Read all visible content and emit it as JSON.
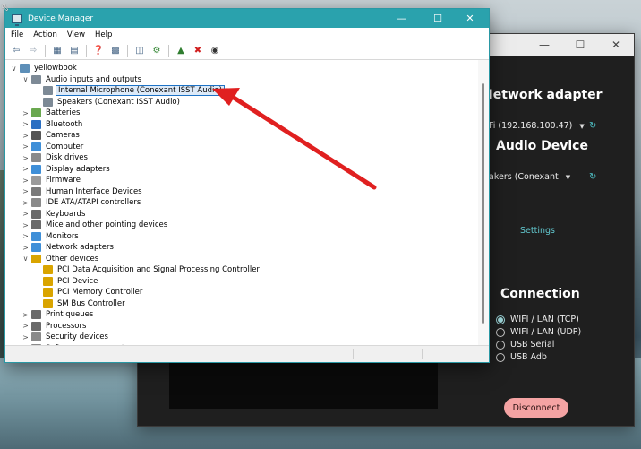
{
  "device_manager": {
    "title": "Device Manager",
    "menu": [
      "File",
      "Action",
      "View",
      "Help"
    ],
    "toolbar_icons": [
      "back-arrow-icon",
      "forward-arrow-icon",
      "properties-grid-icon",
      "list-icon",
      "help-icon",
      "properties-icon",
      "monitor-icon",
      "scan-icon",
      "update-driver-icon",
      "uninstall-icon",
      "download-icon"
    ],
    "tree": [
      {
        "label": "yellowbook",
        "level": 0,
        "expander": "expanded",
        "icon": "computer-icon",
        "color": "#5d8fb8"
      },
      {
        "label": "Audio inputs and outputs",
        "level": 1,
        "expander": "expanded",
        "icon": "speaker-icon",
        "color": "#7d8a96"
      },
      {
        "label": "Internal Microphone (Conexant ISST Audio)",
        "level": 2,
        "expander": "none",
        "icon": "microphone-icon",
        "color": "#7d8a96",
        "selected": true
      },
      {
        "label": "Speakers (Conexant ISST Audio)",
        "level": 2,
        "expander": "none",
        "icon": "speaker-icon",
        "color": "#7d8a96"
      },
      {
        "label": "Batteries",
        "level": 1,
        "expander": "collapsed",
        "icon": "battery-icon",
        "color": "#6aa84f"
      },
      {
        "label": "Bluetooth",
        "level": 1,
        "expander": "collapsed",
        "icon": "bluetooth-icon",
        "color": "#2b6fc2"
      },
      {
        "label": "Cameras",
        "level": 1,
        "expander": "collapsed",
        "icon": "camera-icon",
        "color": "#555555"
      },
      {
        "label": "Computer",
        "level": 1,
        "expander": "collapsed",
        "icon": "monitor-icon",
        "color": "#3f8fd8"
      },
      {
        "label": "Disk drives",
        "level": 1,
        "expander": "collapsed",
        "icon": "disk-drive-icon",
        "color": "#8a8a8a"
      },
      {
        "label": "Display adapters",
        "level": 1,
        "expander": "collapsed",
        "icon": "display-adapter-icon",
        "color": "#3f8fd8"
      },
      {
        "label": "Firmware",
        "level": 1,
        "expander": "collapsed",
        "icon": "firmware-icon",
        "color": "#9a9a9a"
      },
      {
        "label": "Human Interface Devices",
        "level": 1,
        "expander": "collapsed",
        "icon": "hid-icon",
        "color": "#7a7a7a"
      },
      {
        "label": "IDE ATA/ATAPI controllers",
        "level": 1,
        "expander": "collapsed",
        "icon": "ide-controller-icon",
        "color": "#8a8a8a"
      },
      {
        "label": "Keyboards",
        "level": 1,
        "expander": "collapsed",
        "icon": "keyboard-icon",
        "color": "#6a6a6a"
      },
      {
        "label": "Mice and other pointing devices",
        "level": 1,
        "expander": "collapsed",
        "icon": "mouse-icon",
        "color": "#6a6a6a"
      },
      {
        "label": "Monitors",
        "level": 1,
        "expander": "collapsed",
        "icon": "monitor-icon",
        "color": "#3f8fd8"
      },
      {
        "label": "Network adapters",
        "level": 1,
        "expander": "collapsed",
        "icon": "network-adapter-icon",
        "color": "#3f8fd8"
      },
      {
        "label": "Other devices",
        "level": 1,
        "expander": "expanded",
        "icon": "unknown-device-icon",
        "color": "#d9a400"
      },
      {
        "label": "PCI Data Acquisition and Signal Processing Controller",
        "level": 2,
        "expander": "none",
        "icon": "warning-device-icon",
        "color": "#d9a400"
      },
      {
        "label": "PCI Device",
        "level": 2,
        "expander": "none",
        "icon": "warning-device-icon",
        "color": "#d9a400"
      },
      {
        "label": "PCI Memory Controller",
        "level": 2,
        "expander": "none",
        "icon": "warning-device-icon",
        "color": "#d9a400"
      },
      {
        "label": "SM Bus Controller",
        "level": 2,
        "expander": "none",
        "icon": "warning-device-icon",
        "color": "#d9a400"
      },
      {
        "label": "Print queues",
        "level": 1,
        "expander": "collapsed",
        "icon": "printer-icon",
        "color": "#6a6a6a"
      },
      {
        "label": "Processors",
        "level": 1,
        "expander": "collapsed",
        "icon": "processor-icon",
        "color": "#6a6a6a"
      },
      {
        "label": "Security devices",
        "level": 1,
        "expander": "collapsed",
        "icon": "security-device-icon",
        "color": "#8a8a8a"
      },
      {
        "label": "Software components",
        "level": 1,
        "expander": "collapsed",
        "icon": "software-component-icon",
        "color": "#8a8a8a"
      }
    ]
  },
  "app": {
    "network_heading": "Network adapter",
    "network_value": "Fi (192.168.100.47)",
    "audio_heading": "Audio Device",
    "audio_value": "akers (Conexant",
    "settings_label": "Settings",
    "connection_heading": "Connection",
    "connection_options": [
      {
        "label": "WIFI / LAN (TCP)",
        "selected": true
      },
      {
        "label": "WIFI / LAN (UDP)",
        "selected": false
      },
      {
        "label": "USB Serial",
        "selected": false
      },
      {
        "label": "USB Adb",
        "selected": false
      }
    ],
    "disconnect_label": "Disconnect"
  },
  "annotation": {
    "arrow_color": "#e02020"
  }
}
